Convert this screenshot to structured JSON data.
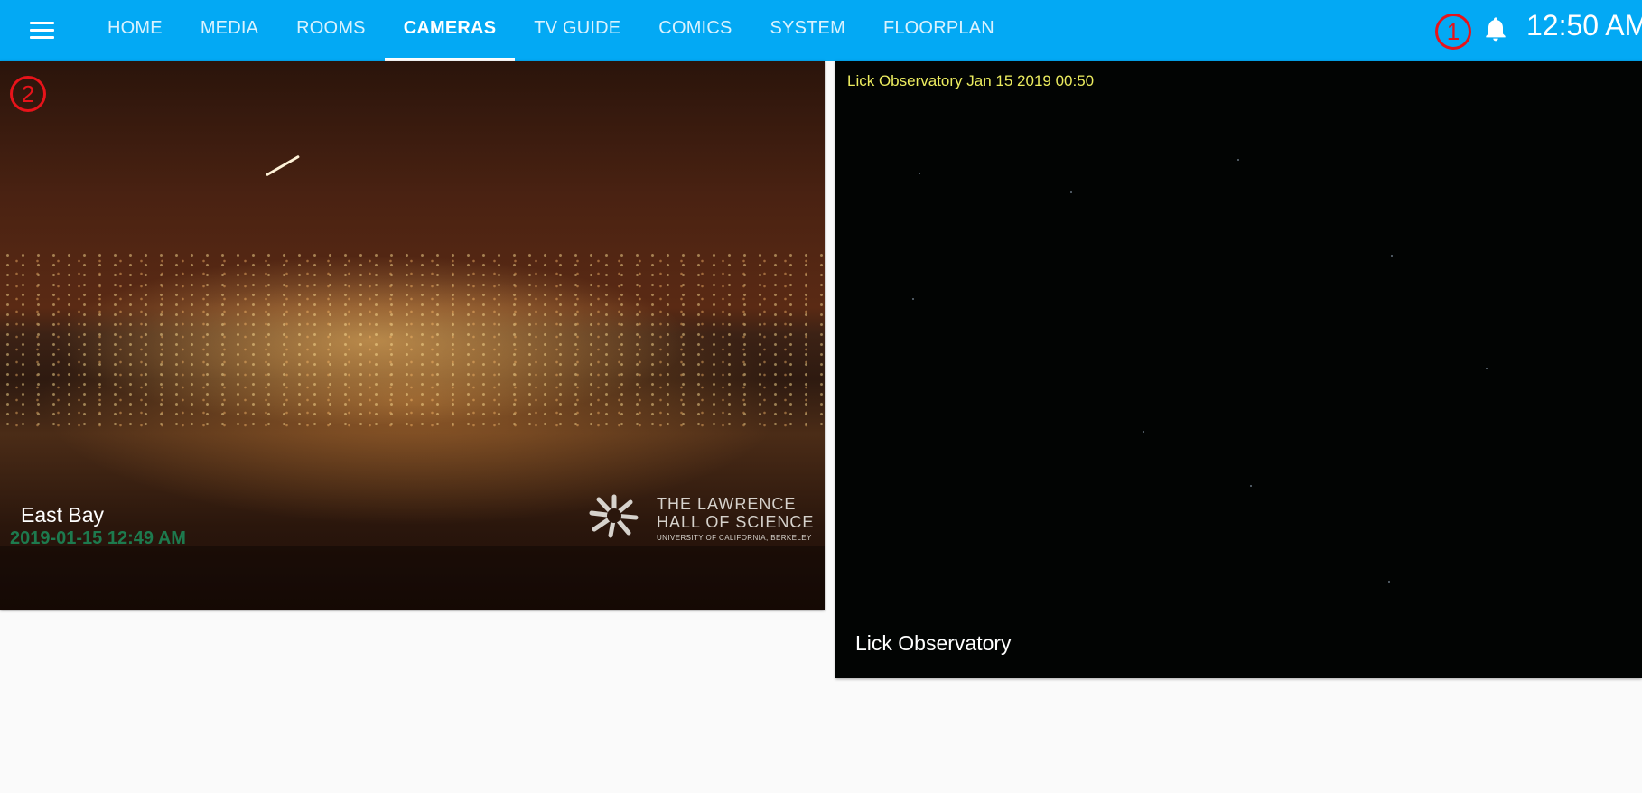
{
  "toolbar": {
    "menu_icon": "hamburger-menu-icon",
    "tabs": [
      {
        "label": "HOME"
      },
      {
        "label": "MEDIA"
      },
      {
        "label": "ROOMS"
      },
      {
        "label": "CAMERAS",
        "active": true
      },
      {
        "label": "TV GUIDE"
      },
      {
        "label": "COMICS"
      },
      {
        "label": "SYSTEM"
      },
      {
        "label": "FLOORPLAN"
      }
    ],
    "notification_icon": "bell-icon",
    "clock": "12:50 AM",
    "background_color": "#03a9f4"
  },
  "annotations": {
    "marker_1": "1",
    "marker_2": "2",
    "color": "#e8131a"
  },
  "cameras": [
    {
      "name": "East Bay",
      "image_timestamp": "2019-01-15 12:49 AM",
      "watermark": {
        "line1": "THE LAWRENCE",
        "line2": "HALL OF SCIENCE",
        "line3": "UNIVERSITY OF CALIFORNIA, BERKELEY"
      }
    },
    {
      "name": "Lick Observatory",
      "image_timestamp": "Lick Observatory Jan 15 2019 00:50"
    }
  ]
}
